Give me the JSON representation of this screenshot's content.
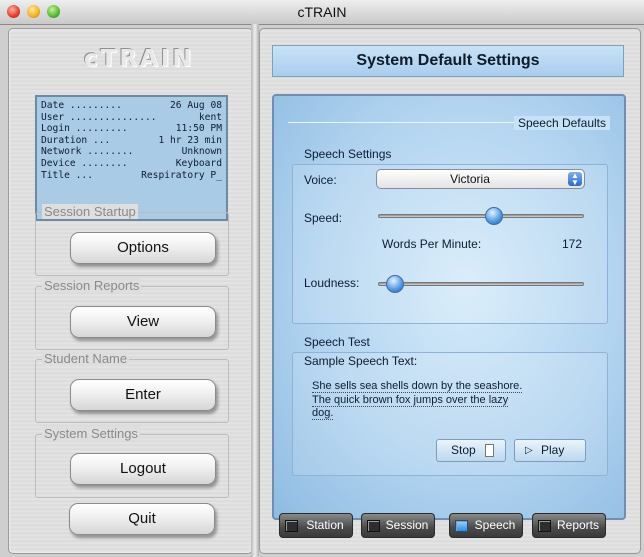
{
  "window": {
    "title": "cTRAIN"
  },
  "left": {
    "logo": "cTRAIN",
    "info": [
      {
        "key": "Date .........",
        "value": "26 Aug 08"
      },
      {
        "key": "User ...............",
        "value": "kent"
      },
      {
        "key": "Login .........",
        "value": "11:50 PM"
      },
      {
        "key": "Duration ...",
        "value": "1 hr 23 min"
      },
      {
        "key": "Network ........",
        "value": "Unknown"
      },
      {
        "key": "Device ........",
        "value": "Keyboard"
      },
      {
        "key": "Title ...",
        "value": "Respiratory P_"
      }
    ],
    "groups": {
      "startup_label": "Session Startup",
      "startup_button": "Options",
      "reports_label": "Session Reports",
      "reports_button": "View",
      "student_label": "Student Name",
      "student_button": "Enter",
      "system_label": "System Settings",
      "system_button": "Logout"
    },
    "quit_button": "Quit"
  },
  "right": {
    "header": "System Default Settings",
    "section_title": "Speech Defaults",
    "speech_settings": {
      "label": "Speech Settings",
      "voice_label": "Voice:",
      "voice_value": "Victoria",
      "speed_label": "Speed:",
      "wpm_label": "Words Per Minute:",
      "wpm_value": "172",
      "speed_fraction": 0.57,
      "loudness_label": "Loudness:",
      "loudness_fraction": 0.04
    },
    "speech_test": {
      "label": "Speech Test",
      "sample_label": "Sample Speech Text:",
      "sample_lines": [
        "She sells sea shells down by the seashore.",
        "The quick brown fox jumps over the lazy",
        "dog."
      ],
      "stop_button": "Stop",
      "play_button": "Play"
    },
    "tabs": [
      {
        "label": "Station",
        "active": false
      },
      {
        "label": "Session",
        "active": false
      },
      {
        "label": "Speech",
        "active": true
      },
      {
        "label": "Reports",
        "active": false
      }
    ]
  },
  "colors": {
    "accent_blue": "#a9cdee",
    "tab_active_icon": "#2a8ee6"
  }
}
